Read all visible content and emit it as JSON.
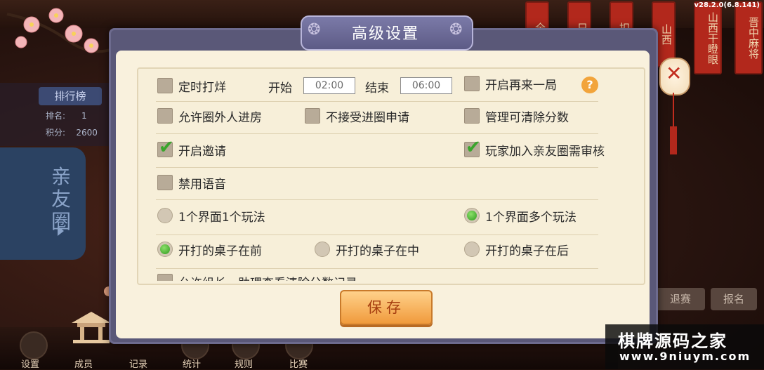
{
  "version": "v28.2.0(6.8.141)",
  "background": {
    "rank_title": "排行榜",
    "rank_label": "排名:",
    "rank_value": "1",
    "score_label": "积分:",
    "score_value": "2600",
    "club_tab": "亲友圈",
    "red_tags": [
      "全",
      "只",
      "扣",
      "山西",
      "山西干瞪眼",
      "晋中麻将"
    ],
    "signup_left": "退赛",
    "signup_right": "报名",
    "bottom_nav": [
      "设置",
      "成员",
      "记录",
      "统计",
      "规则",
      "比赛"
    ]
  },
  "dialog": {
    "title": "高级设置",
    "timed_close": {
      "label": "定时打烊",
      "checked": false
    },
    "start_label": "开始",
    "start_time": "02:00",
    "end_label": "结束",
    "end_time": "06:00",
    "play_again": {
      "label": "开启再来一局",
      "checked": false
    },
    "help_icon": "?",
    "allow_outsiders": {
      "label": "允许圈外人进房",
      "checked": false
    },
    "no_join_request": {
      "label": "不接受进圈申请",
      "checked": false
    },
    "admin_clear_score": {
      "label": "管理可清除分数",
      "checked": false
    },
    "enable_invite": {
      "label": "开启邀请",
      "checked": true
    },
    "join_needs_review": {
      "label": "玩家加入亲友圈需审核",
      "checked": true
    },
    "disable_voice": {
      "label": "禁用语音",
      "checked": false
    },
    "one_game_per_screen": {
      "label": "1个界面1个玩法",
      "selected": false
    },
    "multi_game_per_screen": {
      "label": "1个界面多个玩法",
      "selected": true
    },
    "table_front": {
      "label": "开打的桌子在前",
      "selected": true
    },
    "table_middle": {
      "label": "开打的桌子在中",
      "selected": false
    },
    "table_back": {
      "label": "开打的桌子在后",
      "selected": false
    },
    "allow_view_clear_log": {
      "label": "允许组长、助理查看清除分数记录",
      "checked": false
    },
    "save_label": "保存",
    "close_icon": "close-x-icon"
  },
  "watermark": {
    "line1": "棋牌源码之家",
    "line2": "www.9niuym.com"
  },
  "colors": {
    "dialog_frame": "#5a5878",
    "panel": "#f7efd9",
    "check_green": "#3aa52c",
    "save_orange": "#f09a3c"
  }
}
